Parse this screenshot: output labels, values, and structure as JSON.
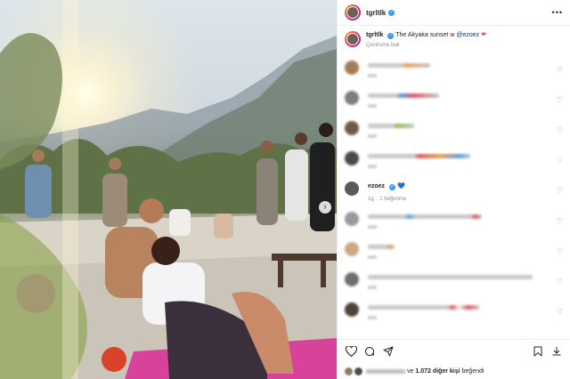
{
  "app": "Instagram",
  "post": {
    "username": "tgrltlk",
    "caption_text": "The Akyaka sunset w",
    "caption_mention": "@ezoez",
    "translate_label": "Çevirisine bak"
  },
  "comments": {
    "visible_reply": {
      "username": "ezoez",
      "age": "1g",
      "likes_label": "1 beğenme"
    }
  },
  "likes_summary": {
    "prefix": "ve",
    "count_text": "1.072 diğer kişi",
    "suffix": "beğendi"
  },
  "icons": {
    "more": "more-options-icon",
    "heart": "heart-icon",
    "comment": "comment-icon",
    "share": "share-icon",
    "save": "bookmark-icon",
    "download": "download-icon",
    "next": "chevron-right-icon"
  },
  "colors": {
    "verified": "#3897f0",
    "like_red": "#ed4956",
    "mention": "#00376b",
    "muted": "#8e8e8e"
  }
}
